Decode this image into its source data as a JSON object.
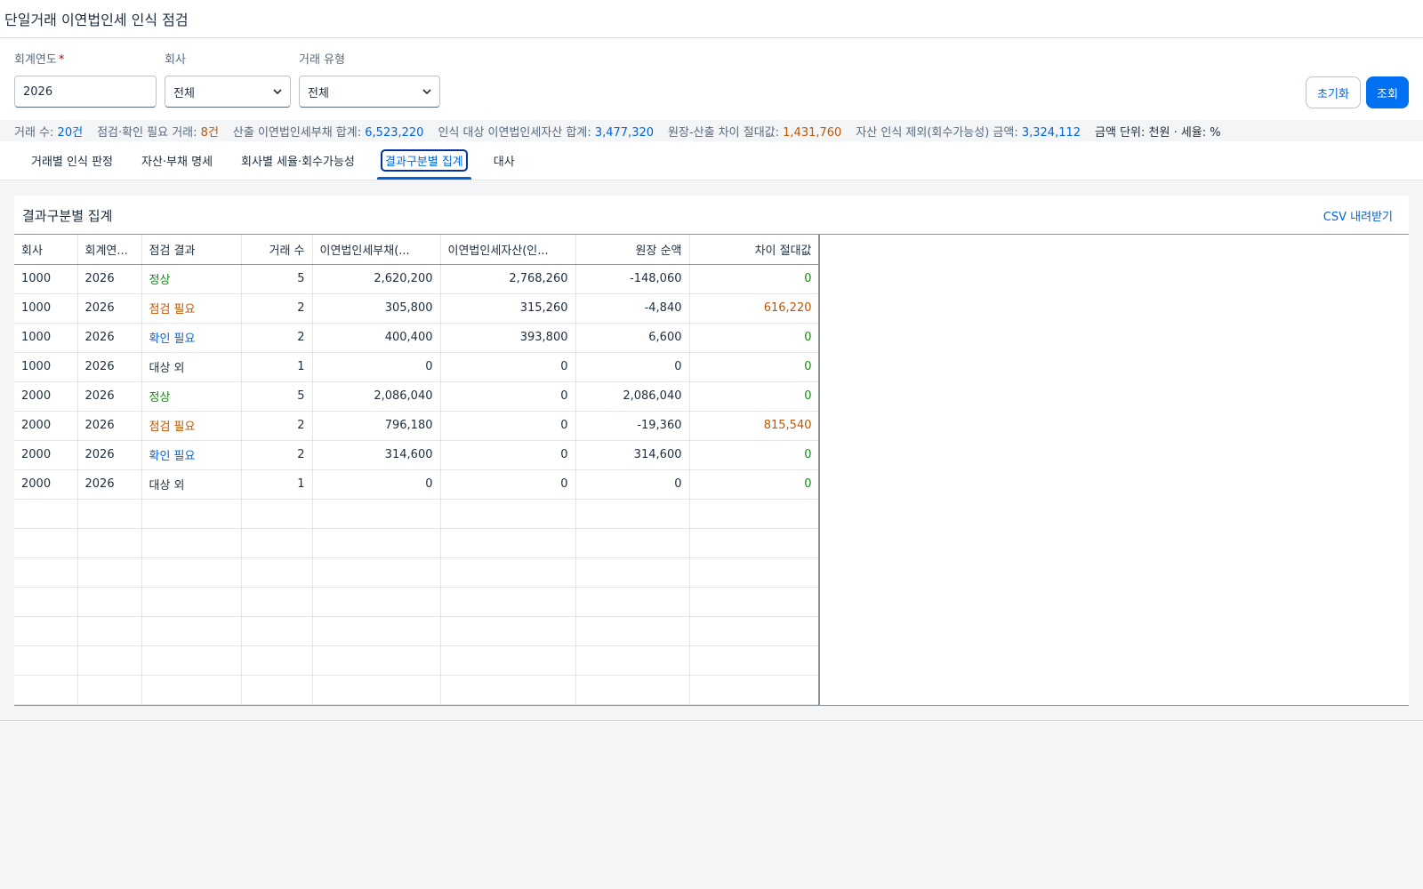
{
  "page": {
    "title": "단일거래 이연법인세 인식 점검"
  },
  "filters": {
    "year": {
      "label": "회계연도",
      "required_mark": "*",
      "value": "2026"
    },
    "company": {
      "label": "회사",
      "value": "전체"
    },
    "type": {
      "label": "거래 유형",
      "value": "전체"
    }
  },
  "buttons": {
    "reset": "초기화",
    "search": "조회"
  },
  "summary": {
    "txn_count_label": "거래 수:",
    "txn_count": "20건",
    "check_needed_label": "점검·확인 필요 거래:",
    "check_needed": "8건",
    "liability_total_label": "산출 이연법인세부채 합계:",
    "liability_total": "6,523,220",
    "asset_total_label": "인식 대상 이연법인세자산 합계:",
    "asset_total": "3,477,320",
    "diff_abs_label": "원장-산출 차이 절대값:",
    "diff_abs": "1,431,760",
    "excluded_label": "자산 인식 제외(회수가능성) 금액:",
    "excluded": "3,324,112",
    "unit": "금액 단위: 천원 · 세율: %"
  },
  "tabs": [
    {
      "label": "거래별 인식 판정",
      "active": false
    },
    {
      "label": "자산·부채 명세",
      "active": false
    },
    {
      "label": "회사별 세율·회수가능성",
      "active": false
    },
    {
      "label": "결과구분별 집계",
      "active": true
    },
    {
      "label": "대사",
      "active": false
    }
  ],
  "panel": {
    "title": "결과구분별 집계",
    "csv": "CSV 내려받기"
  },
  "table": {
    "columns": [
      "회사",
      "회계연...",
      "점검 결과",
      "거래 수",
      "이연법인세부채(...",
      "이연법인세자산(인...",
      "원장 순액",
      "차이 절대값"
    ],
    "rows": [
      [
        "1000",
        "2026",
        "정상",
        "5",
        "2,620,200",
        "2,768,260",
        "-148,060",
        "0"
      ],
      [
        "1000",
        "2026",
        "점검 필요",
        "2",
        "305,800",
        "315,260",
        "-4,840",
        "616,220"
      ],
      [
        "1000",
        "2026",
        "확인 필요",
        "2",
        "400,400",
        "393,800",
        "6,600",
        "0"
      ],
      [
        "1000",
        "2026",
        "대상 외",
        "1",
        "0",
        "0",
        "0",
        "0"
      ],
      [
        "2000",
        "2026",
        "정상",
        "5",
        "2,086,040",
        "0",
        "2,086,040",
        "0"
      ],
      [
        "2000",
        "2026",
        "점검 필요",
        "2",
        "796,180",
        "0",
        "-19,360",
        "815,540"
      ],
      [
        "2000",
        "2026",
        "확인 필요",
        "2",
        "314,600",
        "0",
        "314,600",
        "0"
      ],
      [
        "2000",
        "2026",
        "대상 외",
        "1",
        "0",
        "0",
        "0",
        "0"
      ]
    ]
  },
  "colors": {
    "normal": "#188918",
    "check": "#c35500",
    "confirm": "#0064d9",
    "accent": "#0070f2"
  }
}
